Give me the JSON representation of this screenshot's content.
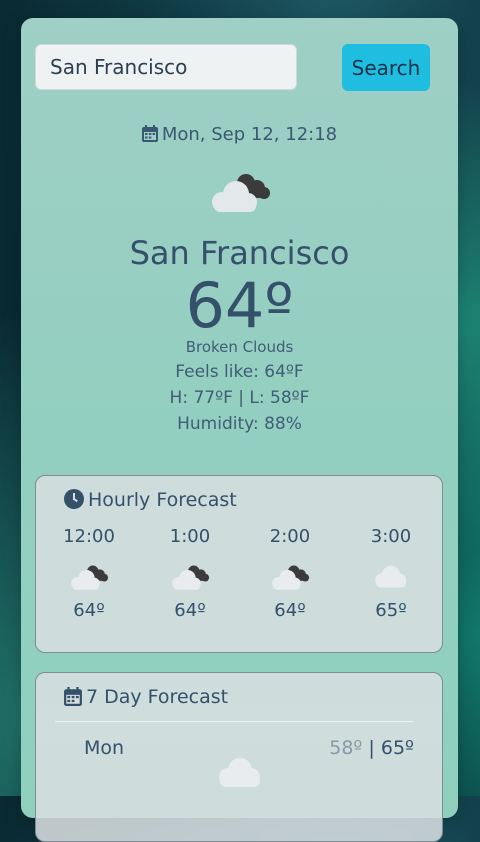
{
  "search": {
    "value": "San Francisco",
    "button_label": "Search"
  },
  "current": {
    "date": "Mon, Sep 12, 12:18",
    "city": "San Francisco",
    "temp": "64º",
    "description": "Broken Clouds",
    "feels_like": "Feels like: 64ºF",
    "high_low": "H: 77ºF | L: 58ºF",
    "humidity": "Humidity: 88%",
    "icon": "broken-clouds-icon"
  },
  "hourly": {
    "title": "Hourly Forecast",
    "items": [
      {
        "time": "12:00",
        "temp": "64º",
        "icon": "broken-clouds-icon"
      },
      {
        "time": "1:00",
        "temp": "64º",
        "icon": "broken-clouds-icon"
      },
      {
        "time": "2:00",
        "temp": "64º",
        "icon": "broken-clouds-icon"
      },
      {
        "time": "3:00",
        "temp": "65º",
        "icon": "cloud-icon"
      }
    ]
  },
  "daily": {
    "title": "7 Day Forecast",
    "items": [
      {
        "day": "Mon",
        "low": "58º",
        "sep": " | ",
        "high": "65º",
        "icon": "cloud-icon"
      }
    ]
  },
  "colors": {
    "accent": "#1fbde0",
    "text": "#34506b"
  }
}
